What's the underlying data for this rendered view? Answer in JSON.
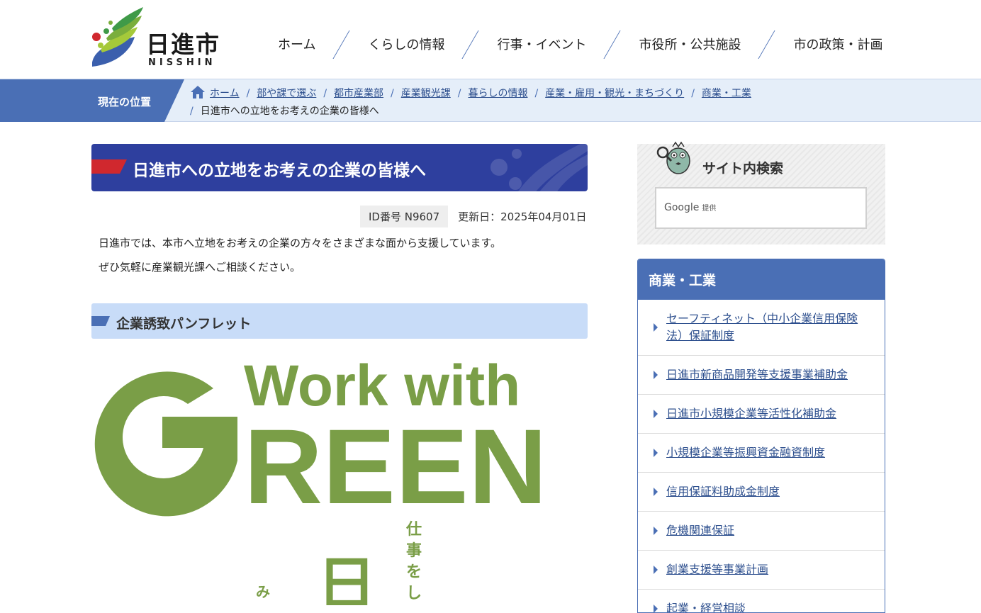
{
  "site": {
    "name": "日進市",
    "name_en": "NISSHIN"
  },
  "gnav": [
    "ホーム",
    "くらしの情報",
    "行事・イベント",
    "市役所・公共施設",
    "市の政策・計画"
  ],
  "breadcrumb": {
    "label": "現在の位置",
    "items": [
      "ホーム",
      "部や課で選ぶ",
      "都市産業部",
      "産業観光課",
      "暮らしの情報",
      "産業・雇用・観光・まちづくり",
      "商業・工業"
    ],
    "current": "日進市への立地をお考えの企業の皆様へ"
  },
  "page": {
    "title": "日進市への立地をお考えの企業の皆様へ",
    "id_label": "ID番号 N9607",
    "updated": "更新日：2025年04月01日",
    "paragraphs": [
      "日進市では、本市へ立地をお考えの企業の方々をさまざまな面から支援しています。",
      "ぜひ気軽に産業観光課へご相談ください。"
    ],
    "section_heading": "企業誘致パンフレット",
    "pamphlet": {
      "line1": "Work with",
      "line2": "GREEN",
      "vertical_main": "日",
      "vertical_text": [
        "仕",
        "事",
        "を",
        "し"
      ],
      "vertical_small": "み",
      "color": "#7a9e47"
    }
  },
  "search": {
    "title": "サイト内検索",
    "provider": "Google",
    "provider_suffix": "提供"
  },
  "sidebar": {
    "heading": "商業・工業",
    "links": [
      "セーフティネット（中小企業信用保険法）保証制度",
      "日進市新商品開発等支援事業補助金",
      "日進市小規模企業等活性化補助金",
      "小規模企業等振興資金融資制度",
      "信用保証料助成金制度",
      "危機関連保証",
      "創業支援等事業計画",
      "起業・経営相談"
    ]
  },
  "colors": {
    "brand_blue": "#4a6fb5",
    "title_navy": "#2e3f9e",
    "green": "#7a9e47",
    "accent_red": "#d0282e"
  }
}
